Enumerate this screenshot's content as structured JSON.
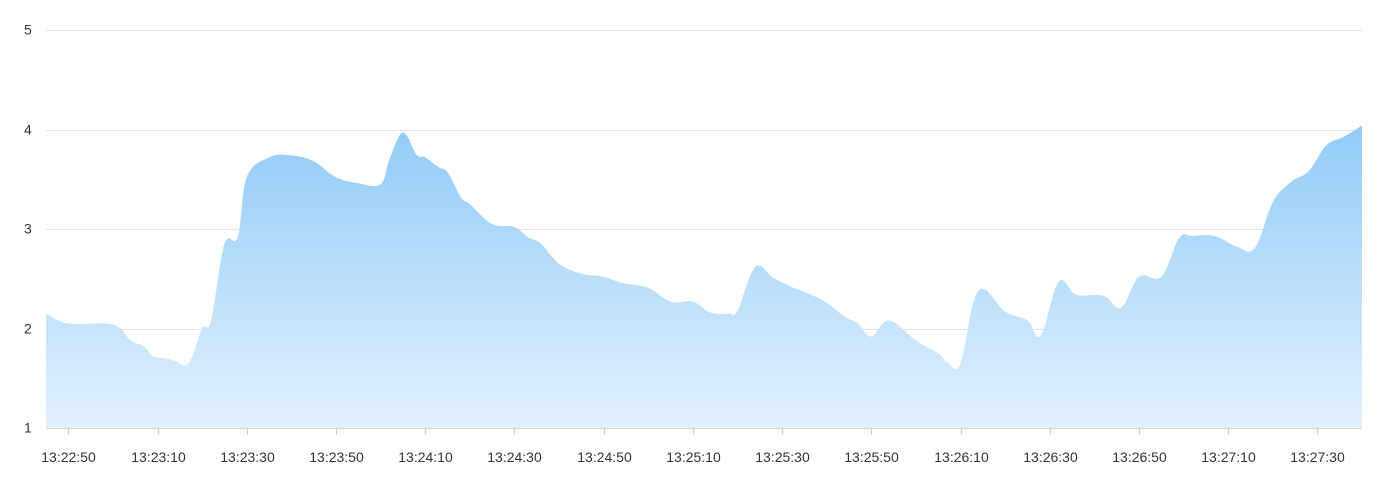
{
  "chart_data": {
    "type": "area",
    "title": "",
    "xlabel": "",
    "ylabel": "",
    "ylim": [
      1,
      5
    ],
    "y_ticks": [
      "1",
      "2",
      "3",
      "4",
      "5"
    ],
    "x_start": "13:22:45",
    "x_end": "13:27:40",
    "x_tick_labels": [
      "13:22:50",
      "13:23:10",
      "13:23:30",
      "13:23:50",
      "13:24:10",
      "13:24:30",
      "13:24:50",
      "13:25:10",
      "13:25:30",
      "13:25:50",
      "13:26:10",
      "13:26:30",
      "13:26:50",
      "13:27:10",
      "13:27:30"
    ],
    "grid": true,
    "legend": "none",
    "colors": {
      "area_top": "#91cbf7",
      "area_bottom": "#e2f1fd",
      "grid": "#e3e3e3",
      "text": "#333333"
    },
    "series": [
      {
        "x": [
          "13:22:45",
          "13:22:50",
          "13:23:00",
          "13:23:04",
          "13:23:07",
          "13:23:09",
          "13:23:12",
          "13:23:14",
          "13:23:17",
          "13:23:20",
          "13:23:22",
          "13:23:25",
          "13:23:28",
          "13:23:30",
          "13:23:35",
          "13:23:40",
          "13:23:45",
          "13:23:50",
          "13:23:55",
          "13:24:00",
          "13:24:02",
          "13:24:05",
          "13:24:08",
          "13:24:10",
          "13:24:13",
          "13:24:15",
          "13:24:18",
          "13:24:20",
          "13:24:25",
          "13:24:30",
          "13:24:33",
          "13:24:36",
          "13:24:40",
          "13:24:45",
          "13:24:50",
          "13:24:54",
          "13:25:00",
          "13:25:05",
          "13:25:10",
          "13:25:14",
          "13:25:18",
          "13:25:20",
          "13:25:24",
          "13:25:28",
          "13:25:32",
          "13:25:36",
          "13:25:40",
          "13:25:44",
          "13:25:47",
          "13:25:50",
          "13:25:54",
          "13:26:00",
          "13:26:05",
          "13:26:07",
          "13:26:10",
          "13:26:14",
          "13:26:20",
          "13:26:25",
          "13:26:28",
          "13:26:32",
          "13:26:36",
          "13:26:42",
          "13:26:46",
          "13:26:50",
          "13:26:55",
          "13:26:59",
          "13:27:02",
          "13:27:07",
          "13:27:12",
          "13:27:16",
          "13:27:20",
          "13:27:24",
          "13:27:28",
          "13:27:32",
          "13:27:36",
          "13:27:40"
        ],
        "values": [
          2.15,
          2.05,
          2.04,
          1.88,
          1.82,
          1.72,
          1.7,
          1.67,
          1.65,
          2.0,
          2.08,
          2.85,
          2.92,
          3.52,
          3.72,
          3.74,
          3.68,
          3.52,
          3.46,
          3.45,
          3.7,
          3.97,
          3.75,
          3.72,
          3.62,
          3.57,
          3.32,
          3.25,
          3.05,
          3.02,
          2.92,
          2.85,
          2.65,
          2.55,
          2.52,
          2.46,
          2.41,
          2.27,
          2.27,
          2.16,
          2.15,
          2.18,
          2.62,
          2.51,
          2.42,
          2.35,
          2.26,
          2.12,
          2.05,
          1.92,
          2.08,
          1.88,
          1.75,
          1.66,
          1.65,
          2.38,
          2.17,
          2.08,
          1.93,
          2.47,
          2.34,
          2.33,
          2.21,
          2.52,
          2.52,
          2.91,
          2.93,
          2.93,
          2.82,
          2.81,
          3.27,
          3.47,
          3.58,
          3.84,
          3.93,
          4.04
        ]
      }
    ]
  }
}
